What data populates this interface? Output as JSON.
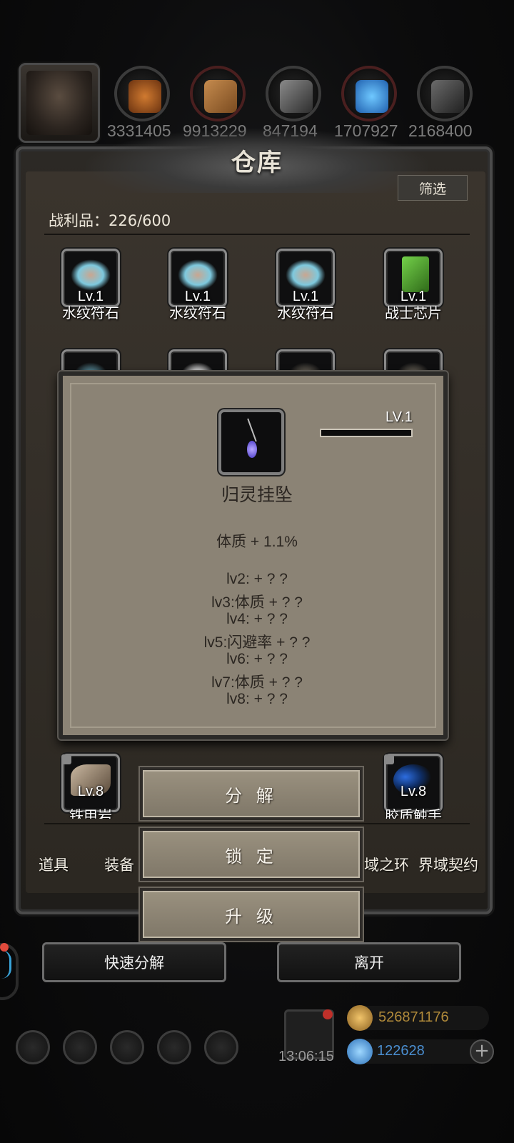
{
  "resources": {
    "values": [
      "3331405",
      "9913229",
      "847194",
      "1707927",
      "2168400"
    ]
  },
  "warehouse": {
    "title": "仓库",
    "filter_label": "筛选",
    "loot_label": "战利品：226/600"
  },
  "items_row1": [
    {
      "lv": "Lv.1",
      "name": "水纹符石"
    },
    {
      "lv": "Lv.1",
      "name": "水纹符石"
    },
    {
      "lv": "Lv.1",
      "name": "水纹符石"
    },
    {
      "lv": "Lv.1",
      "name": "战士芯片"
    }
  ],
  "items_bottom": [
    {
      "lv": "Lv.8",
      "name": "铁甲岩"
    },
    {
      "lv": "Lv.8",
      "name": "胶质触手"
    }
  ],
  "tabs": [
    "道具",
    "装备",
    "域之环",
    "界域契约"
  ],
  "detail": {
    "lv": "LV.1",
    "exp_fraction": 0.0,
    "name": "归灵挂坠",
    "main_stat": "体质 + 1.1%",
    "levels": [
      "lv2: + ? ?",
      "lv3:体质 + ? ?",
      "lv4: + ? ?",
      "lv5:闪避率 + ? ?",
      "lv6: + ? ?",
      "lv7:体质 + ? ?",
      "lv8: + ? ?"
    ]
  },
  "actions": {
    "decompose": "分 解",
    "lock": "锁 定",
    "upgrade": "升 级"
  },
  "bottom": {
    "quick_decompose": "快速分解",
    "leave": "离开"
  },
  "footer": {
    "time": "13:06:15",
    "gold": "526871176",
    "gems": "122628",
    "plus": "+"
  }
}
